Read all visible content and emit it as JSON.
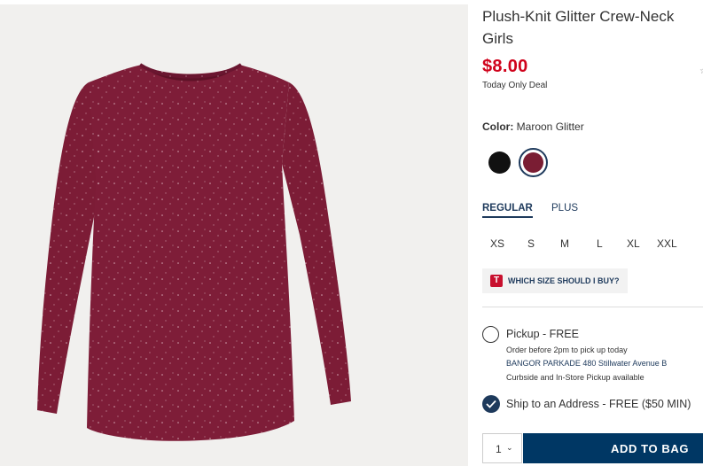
{
  "product": {
    "title_line1": "Plush-Knit Glitter Crew-Neck",
    "title_line2": "Girls",
    "price": "$8.00",
    "deal": "Today Only Deal",
    "image_alt": "maroon-glitter-long-sleeve-tee"
  },
  "colors": {
    "label": "Color:",
    "selected": "Maroon Glitter",
    "swatches": [
      {
        "name": "Black",
        "hex": "#111111"
      },
      {
        "name": "Maroon Glitter",
        "hex": "#7a1d33"
      }
    ]
  },
  "fit_tabs": [
    "REGULAR",
    "PLUS"
  ],
  "sizes": [
    "XS",
    "S",
    "M",
    "L",
    "XL",
    "XXL"
  ],
  "size_guide": {
    "icon": "T",
    "label": "WHICH SIZE SHOULD I BUY?"
  },
  "fulfillment": {
    "pickup_title": "Pickup - FREE",
    "pickup_cutoff": "Order before 2pm to pick up today",
    "pickup_store": "BANGOR PARKADE 480 Stillwater Avenue  B",
    "pickup_note": "Curbside and In-Store Pickup available",
    "ship_title": "Ship to an Address - FREE ($50 MIN)"
  },
  "cart": {
    "quantity": "1",
    "add_label": "ADD TO BAG"
  },
  "colors_theme": {
    "price_red": "#d0021b",
    "navy": "#003764",
    "link_blue": "#1e3a5c"
  }
}
